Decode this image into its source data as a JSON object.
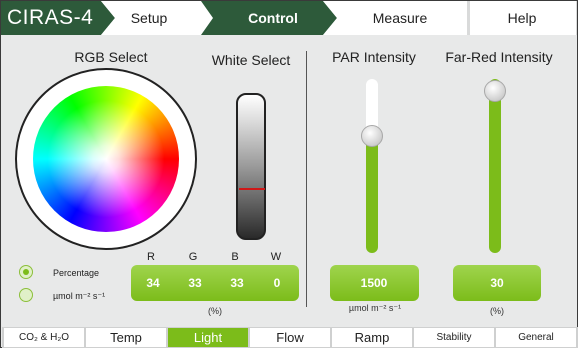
{
  "app": {
    "brand": "CIRAS-4"
  },
  "nav": {
    "setup": "Setup",
    "control": "Control",
    "measure": "Measure",
    "help": "Help"
  },
  "colors": {
    "accent": "#7cbc1a",
    "brand_dark": "#2d5a3a",
    "marker": "#d01818"
  },
  "rgb": {
    "title": "RGB Select",
    "headers": {
      "r": "R",
      "g": "G",
      "b": "B",
      "w": "W"
    },
    "values": {
      "r": "34",
      "g": "33",
      "b": "33",
      "w": "0"
    },
    "unit": "(%)"
  },
  "white": {
    "title": "White Select",
    "level_fraction_from_top": 0.65
  },
  "mode": {
    "percentage_label": "Percentage",
    "umol_label": "µmol m⁻² s⁻¹",
    "selected": "percentage"
  },
  "par": {
    "title": "PAR Intensity",
    "value": "1500",
    "unit": "µmol m⁻² s⁻¹",
    "level_fraction": 0.7
  },
  "farred": {
    "title": "Far-Red Intensity",
    "value": "30",
    "unit": "(%)",
    "level_fraction": 1.0
  },
  "tabs": [
    {
      "label": "CO₂ & H₂O",
      "active": false
    },
    {
      "label": "Temp",
      "active": false
    },
    {
      "label": "Light",
      "active": true
    },
    {
      "label": "Flow",
      "active": false
    },
    {
      "label": "Ramp",
      "active": false
    },
    {
      "label": "Stability",
      "active": false
    },
    {
      "label": "General",
      "active": false
    }
  ]
}
